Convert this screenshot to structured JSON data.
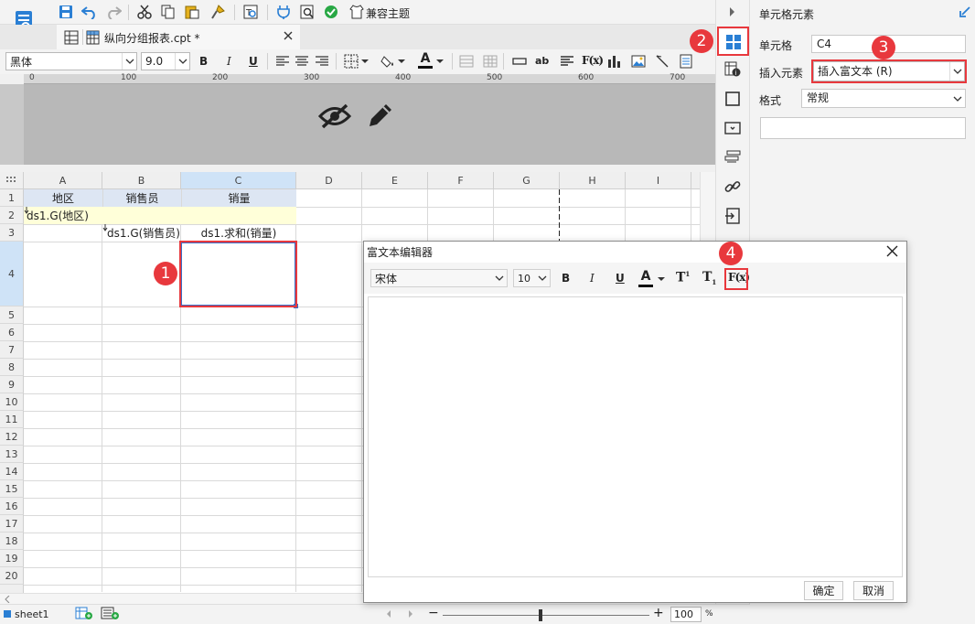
{
  "file_tab": {
    "name": "纵向分组报表.cpt *"
  },
  "toolbar": {
    "theme_label": "兼容主题"
  },
  "format_bar": {
    "font": "黑体",
    "size": "9.0",
    "bold": "B",
    "italic": "I",
    "underline": "U",
    "text_color_glyph": "A",
    "ab": "ab",
    "formula": "F(x)"
  },
  "ruler": {
    "ticks": [
      "0",
      "100",
      "200",
      "300",
      "400",
      "500",
      "600",
      "700"
    ]
  },
  "grid": {
    "columns": [
      "A",
      "B",
      "C",
      "D",
      "E",
      "F",
      "G",
      "H",
      "I"
    ],
    "rows": [
      "1",
      "2",
      "3",
      "4",
      "5",
      "6",
      "7",
      "8",
      "9",
      "10",
      "11",
      "12",
      "13",
      "14",
      "15",
      "16",
      "17",
      "18",
      "19",
      "20"
    ],
    "cells": {
      "a1": "地区",
      "b1": "销售员",
      "c1": "销量",
      "a2": "ds1.G(地区)",
      "b3": "ds1.G(销售员)",
      "c3": "ds1.求和(销量)"
    }
  },
  "panel": {
    "title": "单元格元素",
    "cell_label": "单元格",
    "cell_value": "C4",
    "insert_label": "插入元素",
    "insert_value": "插入富文本 (R)",
    "format_label": "格式",
    "format_value": "常规"
  },
  "dialog": {
    "title": "富文本编辑器",
    "font": "宋体",
    "size": "10",
    "bold": "B",
    "italic": "I",
    "underline": "U",
    "color": "A",
    "sup": "T",
    "sup_mark": "1",
    "sub": "T",
    "sub_mark": "1",
    "formula": "F(x)",
    "ok": "确定",
    "cancel": "取消"
  },
  "status": {
    "sheet": "sheet1",
    "zoom": "100",
    "percent": "%",
    "minus": "−",
    "plus": "+"
  },
  "annotations": [
    "1",
    "2",
    "3",
    "4"
  ],
  "colors": {
    "accent": "#2a7fd4",
    "annotation": "#e8383d",
    "highlight_row": "#ffffd9",
    "header_row": "#dde6f3"
  }
}
